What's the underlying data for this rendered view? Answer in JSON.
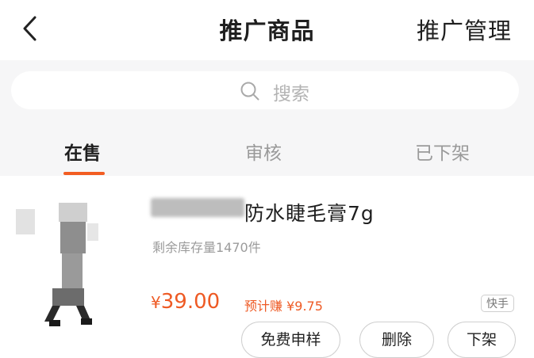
{
  "header": {
    "title": "推广商品",
    "manage_label": "推广管理"
  },
  "search": {
    "placeholder": "搜索"
  },
  "tabs": [
    {
      "label": "在售",
      "active": true
    },
    {
      "label": "审核",
      "active": false
    },
    {
      "label": "已下架",
      "active": false
    }
  ],
  "product": {
    "title_visible": "防水睫毛膏7g",
    "stock": "剩余库存量1470件",
    "price_symbol": "¥",
    "price_value": "39.00",
    "estimated_earning": "预计赚 ¥9.75",
    "platform_badge": "快手"
  },
  "actions": {
    "free_sample": "免费申样",
    "delete": "删除",
    "off_shelf": "下架"
  },
  "colors": {
    "accent": "#ee5a24",
    "page_background": "#f6f6f7"
  },
  "icons": {
    "back": "chevron-left-icon",
    "search": "search-icon"
  }
}
